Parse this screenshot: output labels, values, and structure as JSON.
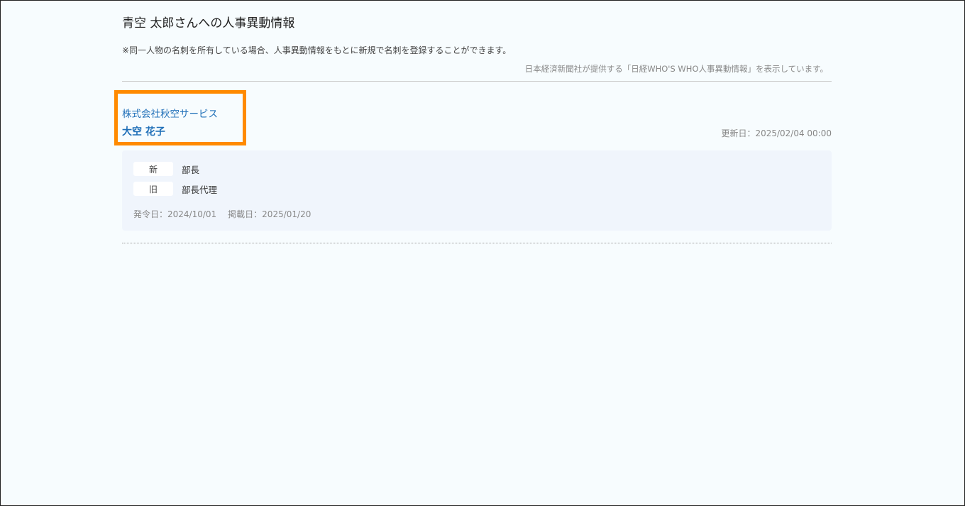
{
  "page": {
    "title": "青空 太郎さんへの人事異動情報",
    "note": "※同一人物の名刺を所有している場合、人事異動情報をもとに新規で名刺を登録することができます。",
    "source": "日本経済新聞社が提供する「日経WHO'S WHO人事異動情報」を表示しています。"
  },
  "entry": {
    "company": "株式会社秋空サービス",
    "person": "大空 花子",
    "updated": "更新日：2025/02/04 00:00",
    "new_tag": "新",
    "new_position": "部長",
    "old_tag": "旧",
    "old_position": "部長代理",
    "issued": "発令日：2024/10/01",
    "published": "掲載日：2025/01/20"
  },
  "colors": {
    "link": "#1f6fb8",
    "highlight": "#ff8a00",
    "card_bg": "#f0f5fc",
    "page_bg": "#f7fcfe"
  }
}
